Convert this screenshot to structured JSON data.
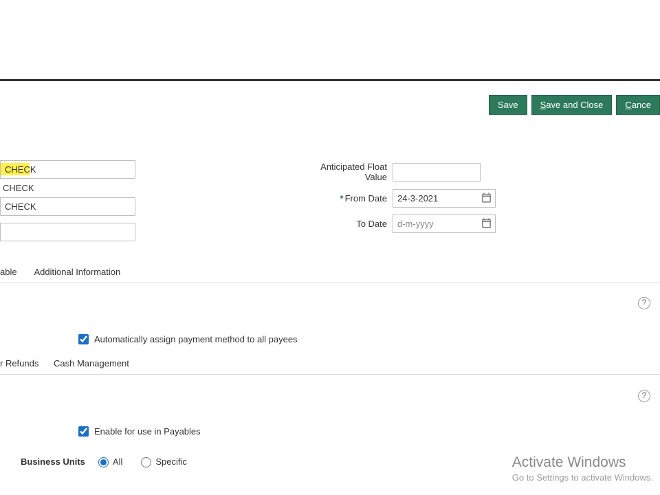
{
  "actions": {
    "save": "Save",
    "save_close_pre": "S",
    "save_close_rest": "ave and Close",
    "cancel_pre": "C",
    "cancel_rest": "ance"
  },
  "left": {
    "field1": "CHECK",
    "readonly2": "CHECK",
    "field3": "CHECK",
    "field4": ""
  },
  "right": {
    "afv_label": "Anticipated Float Value",
    "afv_value": "",
    "from_label": "From Date",
    "from_value": "24-3-2021",
    "to_label": "To Date",
    "to_placeholder": "d-m-yyyy",
    "to_value": ""
  },
  "tabs1": {
    "a": "able",
    "b": "Additional Information"
  },
  "chk1_label": "Automatically assign payment method to all payees",
  "tabs2": {
    "a": "r Refunds",
    "b": "Cash Management"
  },
  "chk2_label": "Enable for use in Payables",
  "radio": {
    "legend": "Business Units",
    "all": "All",
    "specific": "Specific"
  },
  "watermark": {
    "line1": "Activate Windows",
    "line2": "Go to Settings to activate Windows."
  },
  "help_char": "?"
}
